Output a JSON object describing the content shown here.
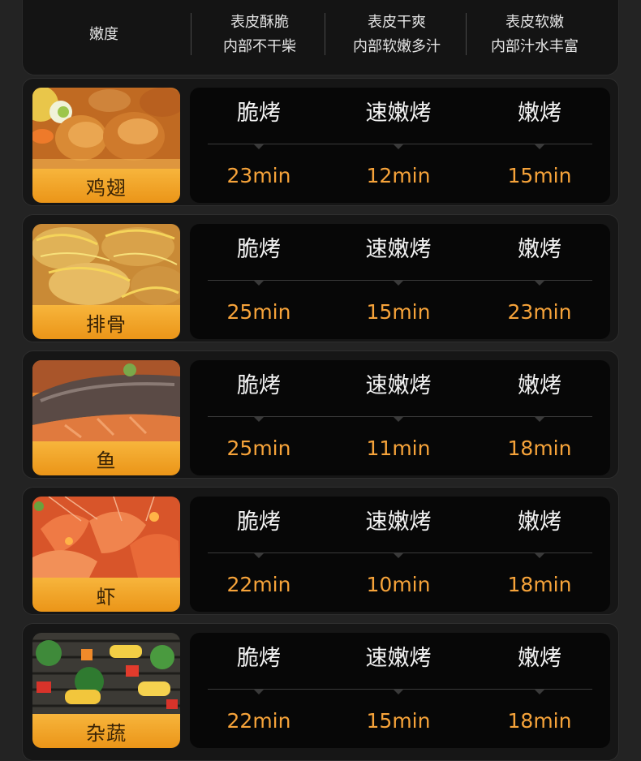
{
  "header": {
    "label": "嫩度",
    "columns": [
      {
        "line1": "表皮酥脆",
        "line2": "内部不干柴"
      },
      {
        "line1": "表皮干爽",
        "line2": "内部软嫩多汁"
      },
      {
        "line1": "表皮软嫩",
        "line2": "内部汁水丰富"
      }
    ]
  },
  "modes": [
    "脆烤",
    "速嫩烤",
    "嫩烤"
  ],
  "rows": [
    {
      "food": "鸡翅",
      "times": [
        "23min",
        "12min",
        "15min"
      ]
    },
    {
      "food": "排骨",
      "times": [
        "25min",
        "15min",
        "23min"
      ]
    },
    {
      "food": "鱼",
      "times": [
        "25min",
        "11min",
        "18min"
      ]
    },
    {
      "food": "虾",
      "times": [
        "22min",
        "10min",
        "18min"
      ]
    },
    {
      "food": "杂蔬",
      "times": [
        "22min",
        "15min",
        "18min"
      ]
    }
  ],
  "colors": {
    "accent": "#f6a33a",
    "band": "#f0a028",
    "card": "#161616"
  }
}
